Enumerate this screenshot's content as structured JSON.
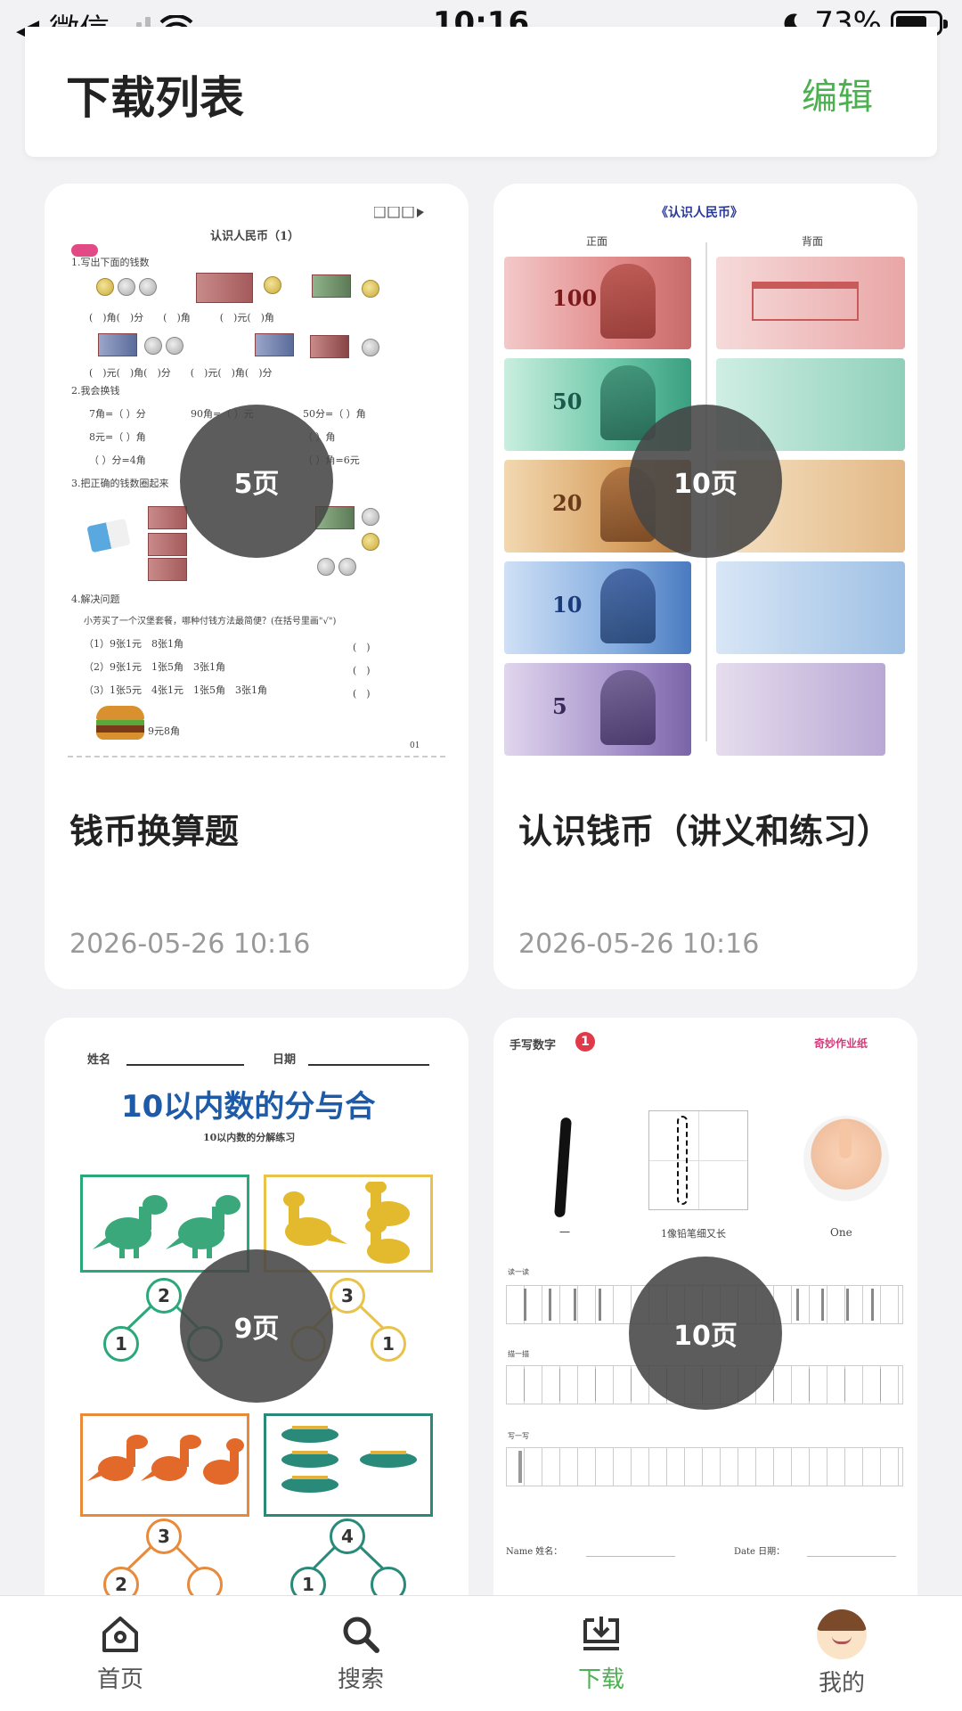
{
  "status_bar": {
    "back_app": "◀ 微信",
    "time": "10:16",
    "battery": "73%"
  },
  "header": {
    "title": "下载列表",
    "edit_label": "编辑"
  },
  "cards": [
    {
      "title": "钱币换算题",
      "date": "2026-05-26 10:16",
      "pages": "5页",
      "thumb": {
        "heading": "认识人民币（1）",
        "q1": "1.写出下面的钱数",
        "q2": "2.我会换钱",
        "q3": "3.把正确的钱数圈起来",
        "q4": "4.解决问题",
        "q4_text": "小芳买了一个汉堡套餐，哪种付钱方法最简便？(在括号里画\"√\")",
        "opt1": "（1）9张1元　8张1角",
        "opt2": "（2）9张1元　1张5角　3张1角",
        "opt3": "（3）1张5元　4张1元　1张5角　3张1角",
        "price": "9元8角",
        "rows": [
          "7角=（ ）分",
          "8元=（ ）角",
          "（ ）分=4角"
        ],
        "rows2": [
          "90角=（ ）元",
          "（ ）角",
          "50分=（ ）角",
          "（ ）角",
          "（ ）角=6元"
        ],
        "page_no": "01"
      }
    },
    {
      "title": "认识钱币（讲义和练习）",
      "date": "2026-05-26 10:16",
      "pages": "10页",
      "thumb": {
        "heading": "《认识人民币》",
        "front": "正面",
        "back": "背面",
        "values": [
          "100",
          "50",
          "20",
          "10",
          "5"
        ]
      }
    },
    {
      "title": "",
      "date": "",
      "pages": "9页",
      "thumb": {
        "name_label": "姓名",
        "date_label": "日期",
        "heading": "10以内数的分与合",
        "subheading": "10以内数的分解练习",
        "nums": [
          "2",
          "1",
          "3",
          "1",
          "3",
          "2",
          "4",
          "1"
        ]
      }
    },
    {
      "title": "",
      "date": "",
      "pages": "10页",
      "thumb": {
        "heading": "手写数字",
        "badge": "1",
        "tag": "奇妙作业纸",
        "caption": "1像铅笔细又长",
        "dash": "一",
        "one": "One",
        "read": "读一读",
        "trace": "描一描",
        "write": "写一写",
        "name": "Name 姓名：",
        "date": "Date 日期："
      }
    }
  ],
  "tabbar": {
    "items": [
      {
        "label": "首页",
        "icon": "home-icon"
      },
      {
        "label": "搜索",
        "icon": "search-icon"
      },
      {
        "label": "下载",
        "icon": "download-icon",
        "active": true
      },
      {
        "label": "我的",
        "icon": "avatar-icon"
      }
    ]
  },
  "colors": {
    "accent": "#4caf50",
    "badge_bg": "#464646"
  }
}
